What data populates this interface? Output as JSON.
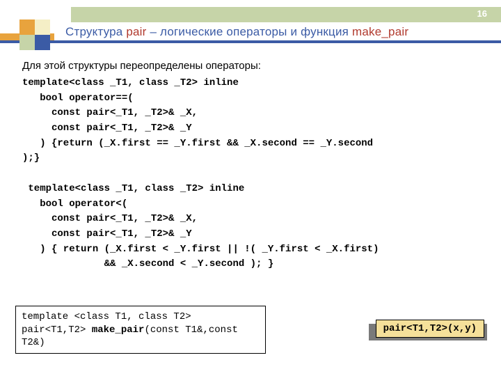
{
  "page_number": "16",
  "title": {
    "pre": "Структура ",
    "pair": "pair",
    "mid": " – логические операторы и функция ",
    "mk": "make_pair"
  },
  "intro": "Для этой структуры переопределены операторы:",
  "code": "template<class _T1, class _T2> inline\n   bool operator==(\n     const pair<_T1, _T2>& _X,\n     const pair<_T1, _T2>& _Y\n   ) {return (_X.first == _Y.first && _X.second == _Y.second\n);}\n\n template<class _T1, class _T2> inline\n   bool operator<(\n     const pair<_T1, _T2>& _X,\n     const pair<_T1, _T2>& _Y\n   ) { return (_X.first < _Y.first || !( _Y.first < _X.first)\n              && _X.second < _Y.second ); }",
  "makepair": {
    "l1": "template <class T1, class T2>",
    "l2a": "  pair<T1,T2> ",
    "l2b": "make_pair",
    "l2c": "(const T1&,const T2&)"
  },
  "paircall": "pair<T1,T2>(x,y)"
}
